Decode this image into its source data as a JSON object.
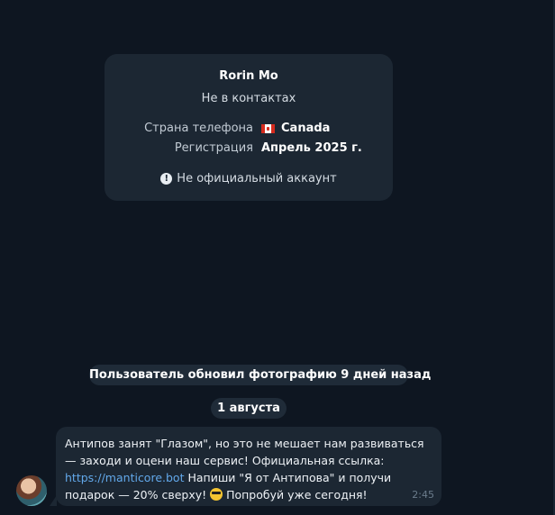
{
  "contact_card": {
    "name": "Rorin Mo",
    "status": "Не в контактах",
    "phone_country_label": "Страна телефона",
    "phone_country_value": "Canada",
    "phone_country_flag": "canada-flag-icon",
    "registration_label": "Регистрация",
    "registration_value": "Апрель 2025 г.",
    "official_notice": "Не официальный аккаунт",
    "official_icon": "exclamation-circle-icon"
  },
  "service_message": "Пользователь обновил фотографию 9 дней назад",
  "date_separator": "1 августа",
  "message": {
    "text_part1": "Антипов занят \"Глазом\", но это не мешает нам развиваться — заходи и оцени наш сервис! Официальная ссылка: ",
    "link": "https://manticore.bot",
    "text_part2": " Напиши \"Я от Антипова\" и получи подарок — 20% сверху! ",
    "emoji": "cool-sunglasses-emoji",
    "text_part3": " Попробуй уже сегодня!",
    "time": "2:45"
  },
  "colors": {
    "background": "#0e1621",
    "card": "#1c2733",
    "link": "#62a8ea",
    "pill": "#1f2b38"
  }
}
